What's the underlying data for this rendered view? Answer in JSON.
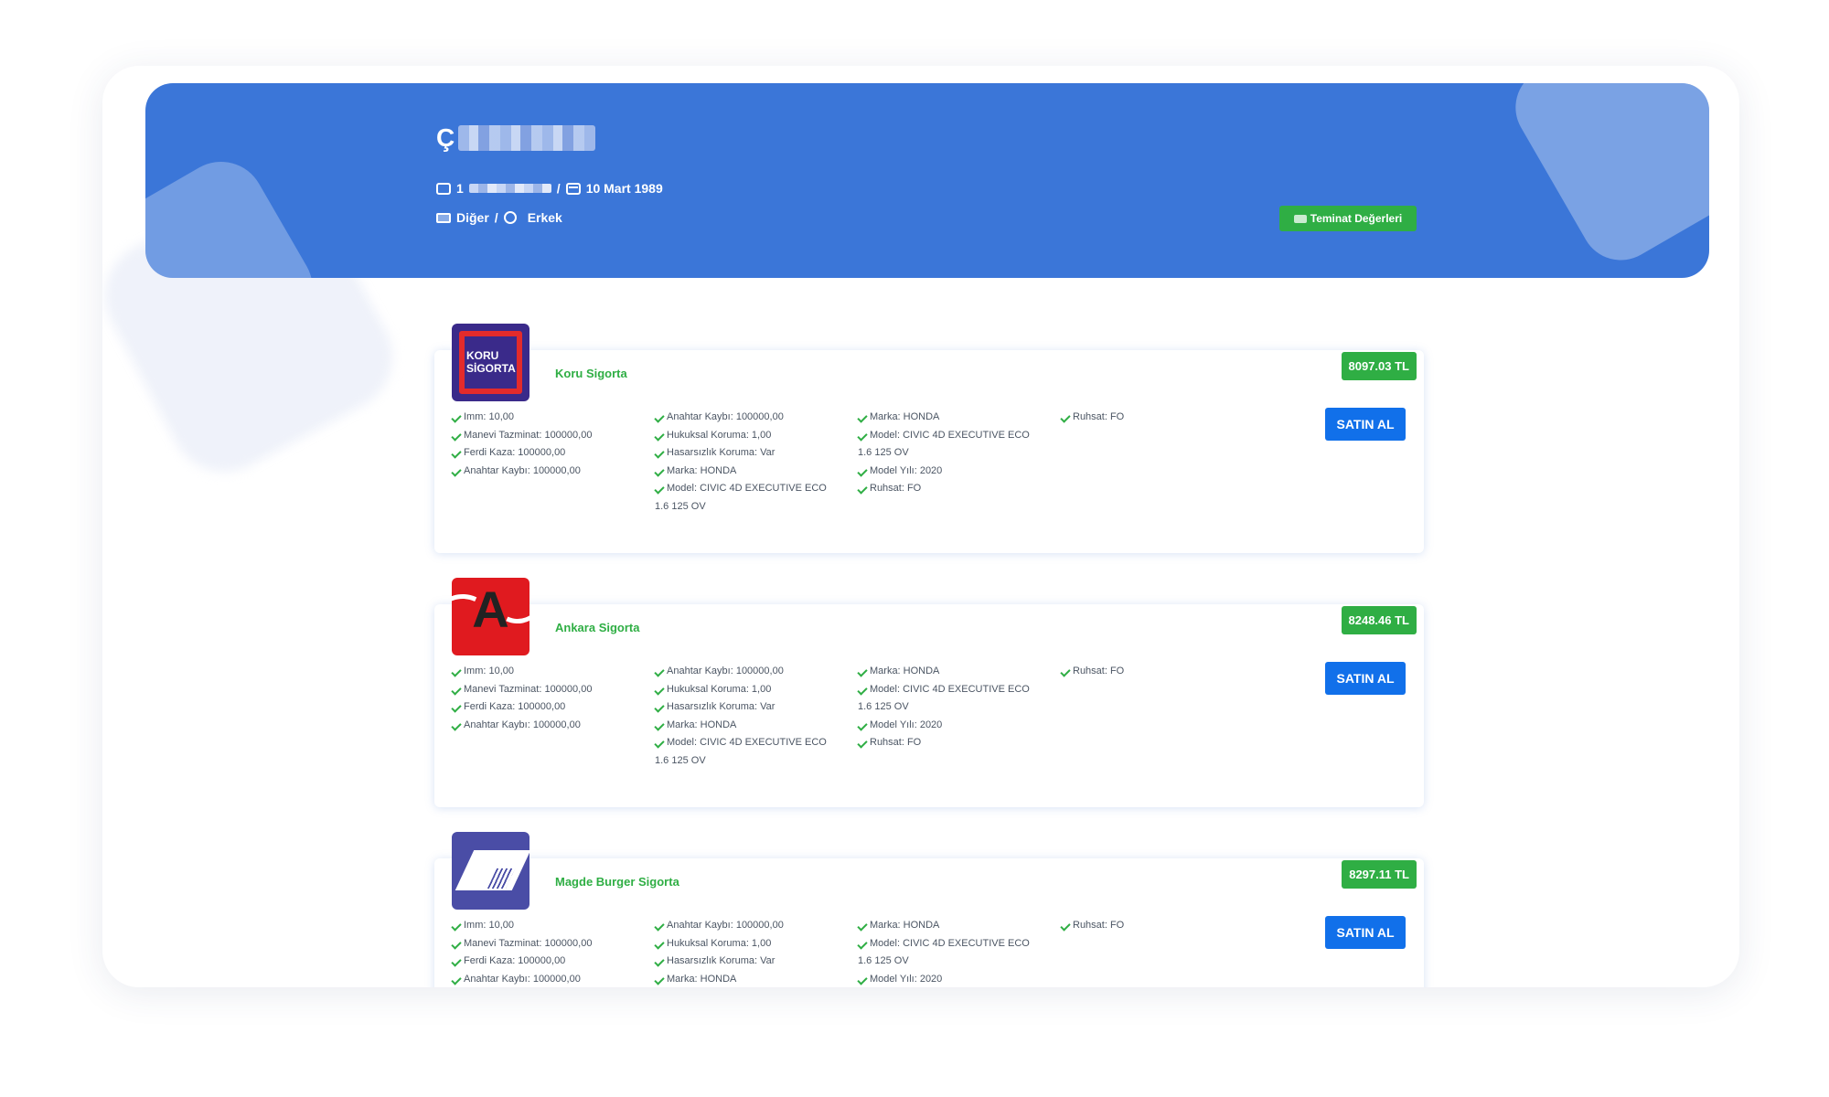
{
  "profile": {
    "name_initial": "Ç",
    "id_prefix": "1",
    "birth_date": "10 Mart 1989",
    "occupation": "Diğer",
    "gender": "Erkek",
    "separator": "/"
  },
  "teminat_button": {
    "label": "Teminat Değerleri",
    "icon": "tag-icon"
  },
  "colors": {
    "banner": "#3b76d8",
    "accent_green": "#2fae44",
    "button_blue": "#1170ea"
  },
  "offers": [
    {
      "company": "Koru Sigorta",
      "logo_text": [
        "KORU",
        "SİGORTA"
      ],
      "price": "8097.03 TL",
      "buy_label": "SATIN AL",
      "features": [
        [
          {
            "text": "Imm: 10,00"
          },
          {
            "text": "Manevi Tazminat: 100000,00"
          },
          {
            "text": "Ferdi Kaza: 100000,00"
          },
          {
            "text": "Anahtar Kaybı: 100000,00"
          }
        ],
        [
          {
            "text": "Anahtar Kaybı: 100000,00"
          },
          {
            "text": "Hukuksal Koruma: 1,00"
          },
          {
            "text": "Hasarsızlık Koruma: Var"
          },
          {
            "text": "Marka: HONDA"
          },
          {
            "text": "Model: CIVIC 4D EXECUTIVE ECO",
            "cont": "1.6 125 OV"
          }
        ],
        [
          {
            "text": "Marka: HONDA"
          },
          {
            "text": "Model: CIVIC 4D EXECUTIVE ECO",
            "cont": "1.6 125 OV"
          },
          {
            "text": "Model Yılı: 2020"
          },
          {
            "text": "Ruhsat: FO"
          }
        ],
        [
          {
            "text": "Ruhsat: FO"
          }
        ]
      ]
    },
    {
      "company": "Ankara Sigorta",
      "logo_text": [
        "A"
      ],
      "price": "8248.46 TL",
      "buy_label": "SATIN AL",
      "features": [
        [
          {
            "text": "Imm: 10,00"
          },
          {
            "text": "Manevi Tazminat: 100000,00"
          },
          {
            "text": "Ferdi Kaza: 100000,00"
          },
          {
            "text": "Anahtar Kaybı: 100000,00"
          }
        ],
        [
          {
            "text": "Anahtar Kaybı: 100000,00"
          },
          {
            "text": "Hukuksal Koruma: 1,00"
          },
          {
            "text": "Hasarsızlık Koruma: Var"
          },
          {
            "text": "Marka: HONDA"
          },
          {
            "text": "Model: CIVIC 4D EXECUTIVE ECO",
            "cont": "1.6 125 OV"
          }
        ],
        [
          {
            "text": "Marka: HONDA"
          },
          {
            "text": "Model: CIVIC 4D EXECUTIVE ECO",
            "cont": "1.6 125 OV"
          },
          {
            "text": "Model Yılı: 2020"
          },
          {
            "text": "Ruhsat: FO"
          }
        ],
        [
          {
            "text": "Ruhsat: FO"
          }
        ]
      ]
    },
    {
      "company": "Magde Burger Sigorta",
      "logo_text": [],
      "price": "8297.11 TL",
      "buy_label": "SATIN AL",
      "features": [
        [
          {
            "text": "Imm: 10,00"
          },
          {
            "text": "Manevi Tazminat: 100000,00"
          },
          {
            "text": "Ferdi Kaza: 100000,00"
          },
          {
            "text": "Anahtar Kaybı: 100000,00"
          }
        ],
        [
          {
            "text": "Anahtar Kaybı: 100000,00"
          },
          {
            "text": "Hukuksal Koruma: 1,00"
          },
          {
            "text": "Hasarsızlık Koruma: Var"
          },
          {
            "text": "Marka: HONDA"
          }
        ],
        [
          {
            "text": "Marka: HONDA"
          },
          {
            "text": "Model: CIVIC 4D EXECUTIVE ECO",
            "cont": "1.6 125 OV"
          },
          {
            "text": "Model Yılı: 2020"
          }
        ],
        [
          {
            "text": "Ruhsat: FO"
          }
        ]
      ]
    }
  ]
}
